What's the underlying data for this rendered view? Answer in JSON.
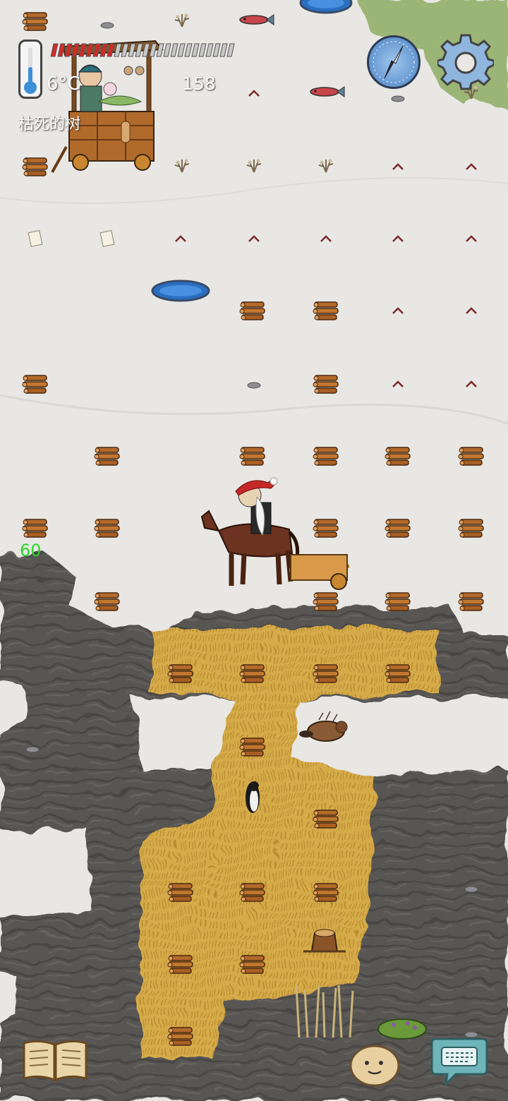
{
  "hud": {
    "temperature": "6°C",
    "location": "枯死的树",
    "step_count": "158",
    "fps": "60",
    "health_fraction": 0.35,
    "icons": {
      "thermometer": "thermometer-icon",
      "compass": "compass-icon",
      "settings": "gear-icon",
      "journal": "open-book-icon",
      "emote": "potato-face-icon",
      "chat": "keyboard-bubble-icon"
    }
  },
  "world": {
    "snow_color": "#e8e7e4",
    "grass_color": "#d4aa47",
    "rock_color": "#55524f",
    "moss_color": "#9bb576",
    "items": [
      "firewood",
      "rabbit-trail",
      "fish",
      "ice-hole",
      "dead-plant",
      "paper-note",
      "stone",
      "merchant-cart",
      "horse-rider",
      "wooden-cart",
      "penguin",
      "beaver",
      "tree-stump",
      "reeds",
      "bush"
    ]
  }
}
